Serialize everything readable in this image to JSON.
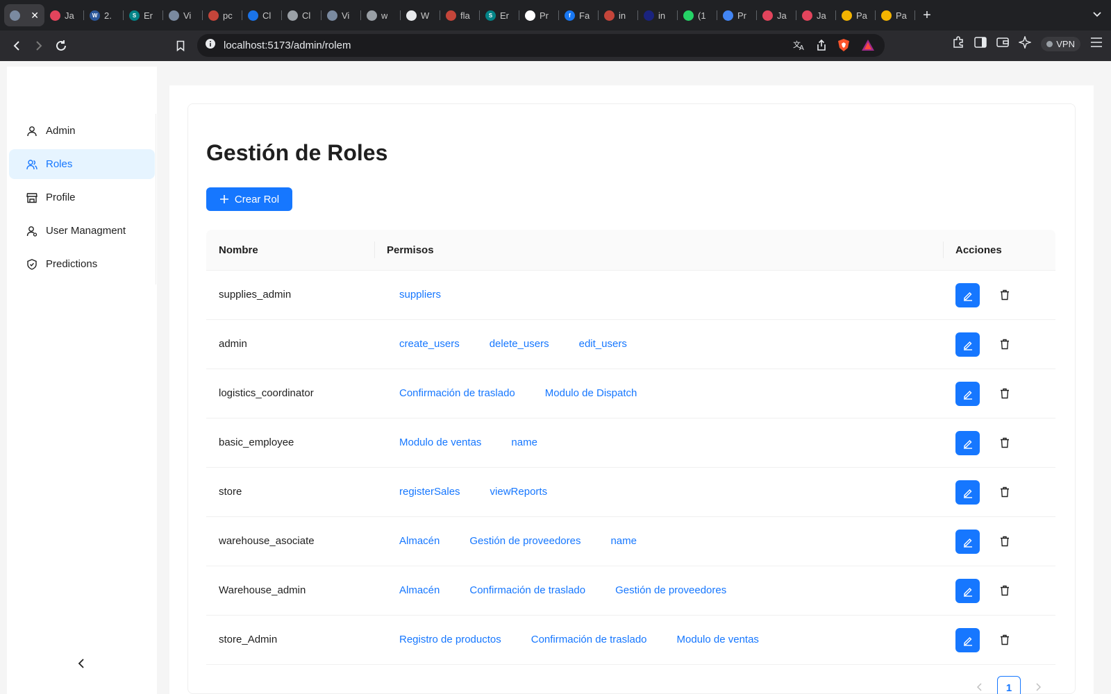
{
  "browser": {
    "tabs": [
      {
        "title": "",
        "icon": "app-logo-icon",
        "color": "#7a8aa0",
        "active": true
      },
      {
        "title": "Ja",
        "icon": "jira-icon",
        "color": "#e2445c"
      },
      {
        "title": "2.",
        "icon": "word-icon",
        "color": "#2b579a",
        "glyph": "W"
      },
      {
        "title": "Er",
        "icon": "sharepoint-icon",
        "color": "#038387",
        "glyph": "S"
      },
      {
        "title": "Vi",
        "icon": "app-logo-icon",
        "color": "#7a8aa0"
      },
      {
        "title": "pc",
        "icon": "brave-shield-icon",
        "color": "#c4453a"
      },
      {
        "title": "Cl",
        "icon": "cloud-icon",
        "color": "#1a73e8"
      },
      {
        "title": "Cl",
        "icon": "openai-icon",
        "color": "#9aa0a6"
      },
      {
        "title": "Vi",
        "icon": "app-logo-icon",
        "color": "#7a8aa0"
      },
      {
        "title": "w",
        "icon": "globe-icon",
        "color": "#9aa0a6"
      },
      {
        "title": "W",
        "icon": "github-icon",
        "color": "#e8eaed"
      },
      {
        "title": "fla",
        "icon": "brave-shield-icon",
        "color": "#c4453a"
      },
      {
        "title": "Er",
        "icon": "sharepoint-icon",
        "color": "#038387",
        "glyph": "S"
      },
      {
        "title": "Pr",
        "icon": "vd-icon",
        "color": "#ffffff"
      },
      {
        "title": "Fa",
        "icon": "facebook-icon",
        "color": "#1877f2",
        "glyph": "f"
      },
      {
        "title": "in",
        "icon": "brave-shield-icon",
        "color": "#c4453a"
      },
      {
        "title": "in",
        "icon": "slash-icon",
        "color": "#1a237e"
      },
      {
        "title": "(1",
        "icon": "whatsapp-icon",
        "color": "#25d366"
      },
      {
        "title": "Pr",
        "icon": "docs-icon",
        "color": "#4285f4"
      },
      {
        "title": "Ja",
        "icon": "jira-icon",
        "color": "#e2445c"
      },
      {
        "title": "Ja",
        "icon": "jira-icon",
        "color": "#e2445c"
      },
      {
        "title": "Pa",
        "icon": "slides-icon",
        "color": "#f4b400"
      },
      {
        "title": "Pa",
        "icon": "slides-icon",
        "color": "#f4b400"
      }
    ],
    "url": "localhost:5173/admin/rolem",
    "vpn_label": "VPN"
  },
  "sidebar": {
    "items": [
      {
        "label": "Admin",
        "icon": "user-icon",
        "active": false
      },
      {
        "label": "Roles",
        "icon": "users-icon",
        "active": true
      },
      {
        "label": "Profile",
        "icon": "shop-icon",
        "active": false
      },
      {
        "label": "User Managment",
        "icon": "user-gear-icon",
        "active": false
      },
      {
        "label": "Predictions",
        "icon": "shield-icon",
        "active": false
      }
    ]
  },
  "page": {
    "title": "Gestión de Roles",
    "create_label": "Crear Rol"
  },
  "table": {
    "headers": {
      "name": "Nombre",
      "permissions": "Permisos",
      "actions": "Acciones"
    },
    "rows": [
      {
        "name": "supplies_admin",
        "permissions": [
          "suppliers"
        ]
      },
      {
        "name": "admin",
        "permissions": [
          "create_users",
          "delete_users",
          "edit_users"
        ]
      },
      {
        "name": "logistics_coordinator",
        "permissions": [
          "Confirmación de traslado",
          "Modulo de Dispatch"
        ]
      },
      {
        "name": "basic_employee",
        "permissions": [
          "Modulo de ventas",
          "name"
        ]
      },
      {
        "name": "store",
        "permissions": [
          "registerSales",
          "viewReports"
        ]
      },
      {
        "name": "warehouse_asociate",
        "permissions": [
          "Almacén",
          "Gestión de proveedores",
          "name"
        ]
      },
      {
        "name": "Warehouse_admin",
        "permissions": [
          "Almacén",
          "Confirmación de traslado",
          "Gestión de proveedores"
        ]
      },
      {
        "name": "store_Admin",
        "permissions": [
          "Registro de productos",
          "Confirmación de traslado",
          "Modulo de ventas"
        ]
      }
    ]
  },
  "pagination": {
    "current": "1"
  },
  "colors": {
    "primary": "#1677ff",
    "active_bg": "#e6f4ff"
  }
}
